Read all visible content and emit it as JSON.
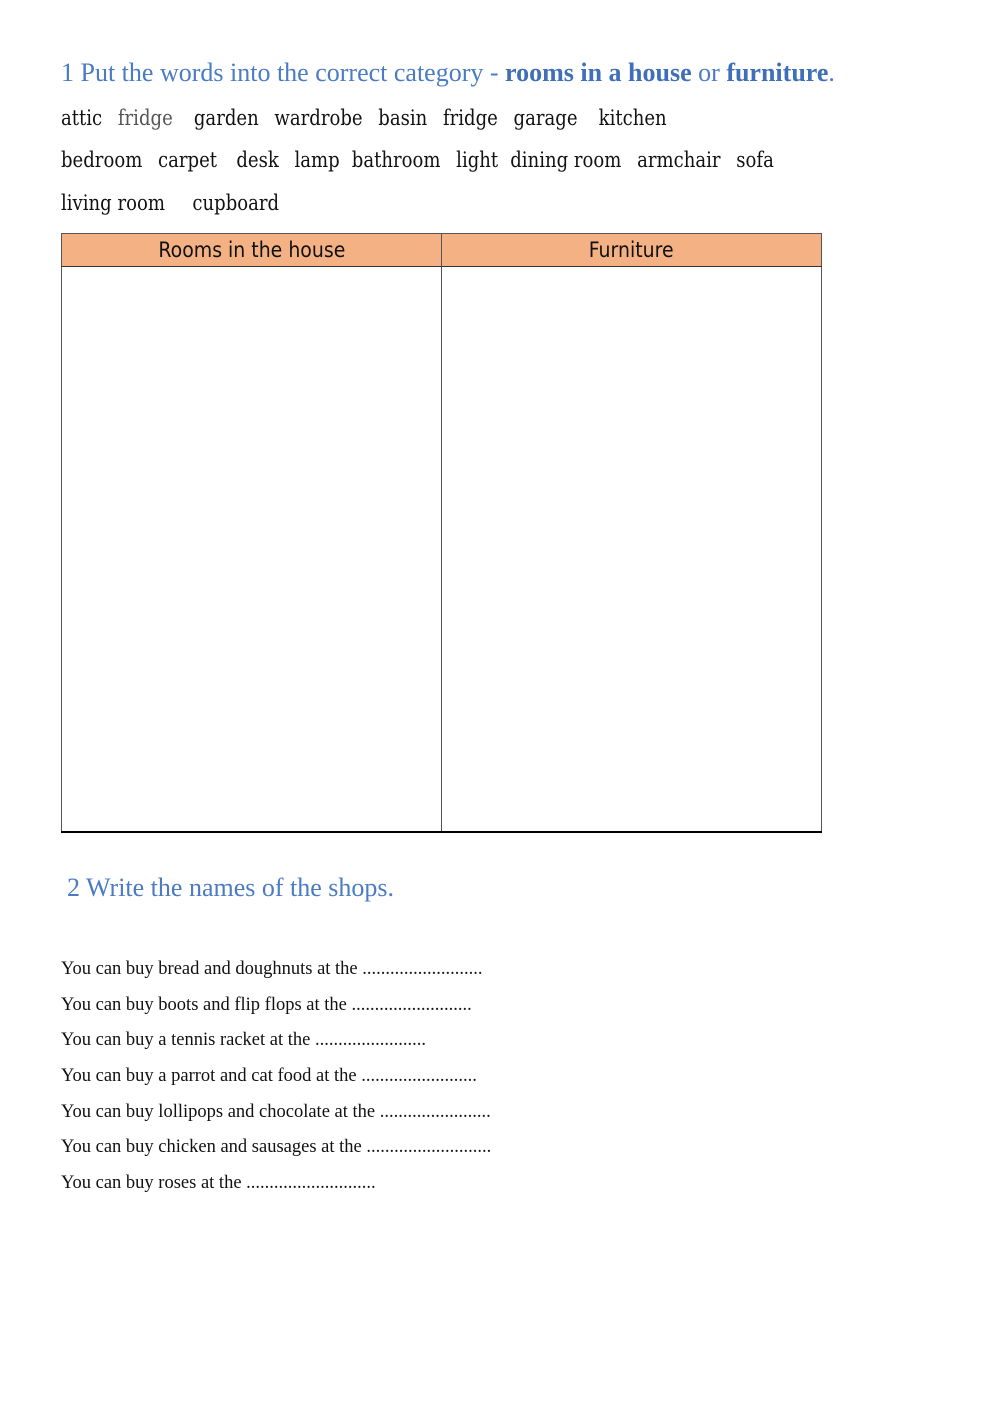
{
  "exercise1": {
    "heading": {
      "prefix": "1 Put the words into the correct category - ",
      "bold1": "rooms in a house",
      "middle": " or ",
      "bold2": "furniture",
      "suffix": "."
    },
    "word_lines": [
      [
        "attic",
        "fridge",
        "garden",
        "wardrobe",
        "basin",
        "fridge",
        "garage",
        "kitchen"
      ],
      [
        "bedroom",
        "carpet",
        "desk",
        "lamp",
        "bathroom",
        "light",
        "dining room",
        "armchair",
        "sofa"
      ],
      [
        "living room",
        "cupboard"
      ]
    ],
    "table": {
      "headers": [
        "Rooms in the house",
        "Furniture"
      ],
      "header_color": "#f4b183"
    }
  },
  "exercise2": {
    "heading": "2 Write the names of the shops.",
    "sentences": [
      "You can buy bread and doughnuts at the  ..........................",
      "You can buy boots and flip flops at the ..........................",
      "You can buy a tennis racket at the ........................",
      "You can buy a parrot and cat food at the .........................",
      "You can buy lollipops and chocolate at the ........................",
      "You can buy chicken and sausages at the ...........................",
      "You can buy roses at the ............................"
    ]
  },
  "colors": {
    "heading_blue": "#4a7bc4"
  }
}
